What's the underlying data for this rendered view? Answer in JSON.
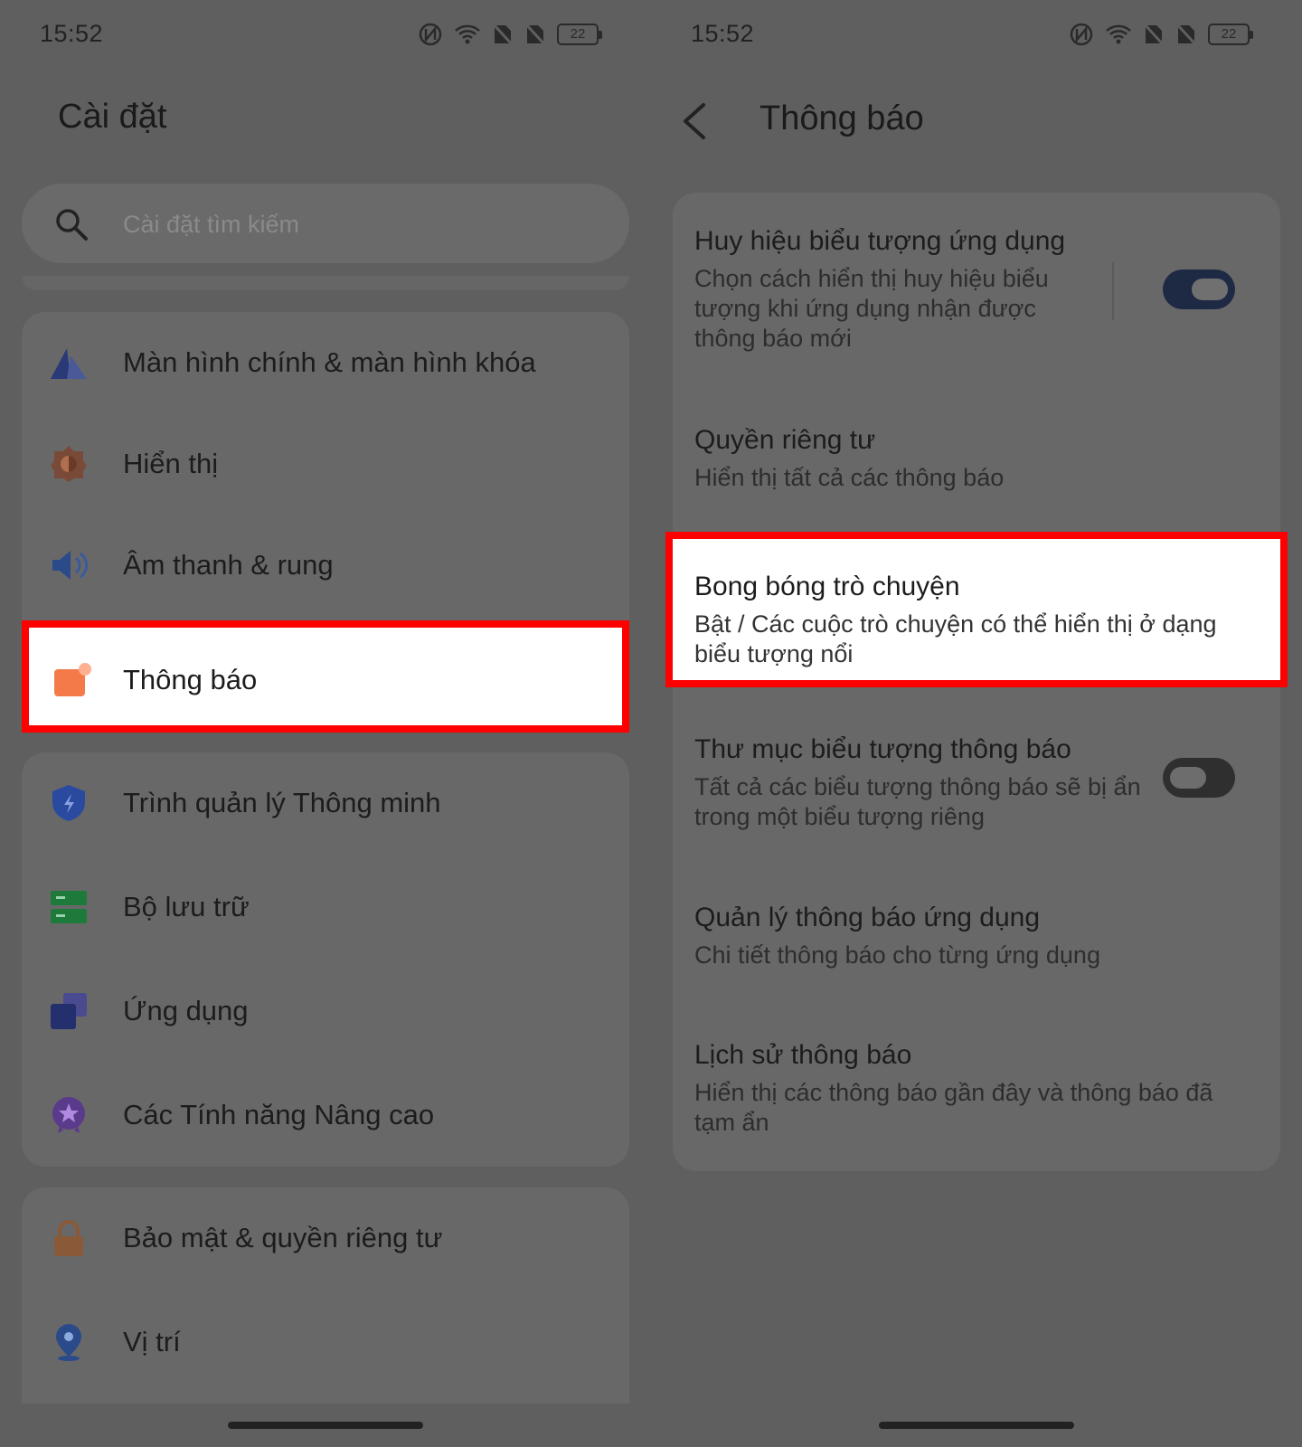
{
  "left": {
    "status": {
      "time": "15:52",
      "battery": "22"
    },
    "title": "Cài đặt",
    "search": {
      "placeholder": "Cài đặt tìm kiếm"
    },
    "groups": [
      {
        "items": [
          {
            "label": "Màn hình chính & màn hình khóa",
            "icon": "home-screen-icon"
          },
          {
            "label": "Hiển thị",
            "icon": "display-icon"
          },
          {
            "label": "Âm thanh & rung",
            "icon": "speaker-icon"
          },
          {
            "label": "Thông báo",
            "icon": "notification-icon",
            "highlighted": true
          }
        ]
      },
      {
        "items": [
          {
            "label": "Trình quản lý Thông minh",
            "icon": "shield-icon"
          },
          {
            "label": "Bộ lưu trữ",
            "icon": "storage-icon"
          },
          {
            "label": "Ứng dụng",
            "icon": "apps-icon"
          },
          {
            "label": "Các Tính năng Nâng cao",
            "icon": "star-badge-icon"
          }
        ]
      },
      {
        "items": [
          {
            "label": "Bảo mật & quyền riêng tư",
            "icon": "lock-icon"
          },
          {
            "label": "Vị trí",
            "icon": "location-icon"
          }
        ]
      }
    ]
  },
  "right": {
    "status": {
      "time": "15:52",
      "battery": "22"
    },
    "title": "Thông báo",
    "items": [
      {
        "title": "Huy hiệu biểu tượng ứng dụng",
        "subtitle": "Chọn cách hiển thị huy hiệu biểu tượng khi ứng dụng nhận được thông báo mới",
        "toggle": "on"
      },
      {
        "title": "Quyền riêng tư",
        "subtitle": "Hiển thị tất cả các thông báo"
      },
      {
        "title": "Bong bóng trò chuyện",
        "subtitle": "Bật / Các cuộc trò chuyện có thể hiển thị ở dạng biểu tượng nổi",
        "highlighted": true
      },
      {
        "title": "Thư mục biểu tượng thông báo",
        "subtitle": "Tất cả các biểu tượng thông báo sẽ bị ẩn trong một biểu tượng riêng",
        "toggle": "off"
      },
      {
        "title": "Quản lý thông báo ứng dụng",
        "subtitle": "Chi tiết thông báo cho từng ứng dụng"
      },
      {
        "title": "Lịch sử thông báo",
        "subtitle": "Hiển thị các thông báo gần đây và thông báo đã tạm ẩn"
      }
    ]
  },
  "colors": {
    "highlight_border": "#ff0000",
    "dim_background": "#5f5f5f",
    "toggle_on": "#1e2a44"
  }
}
